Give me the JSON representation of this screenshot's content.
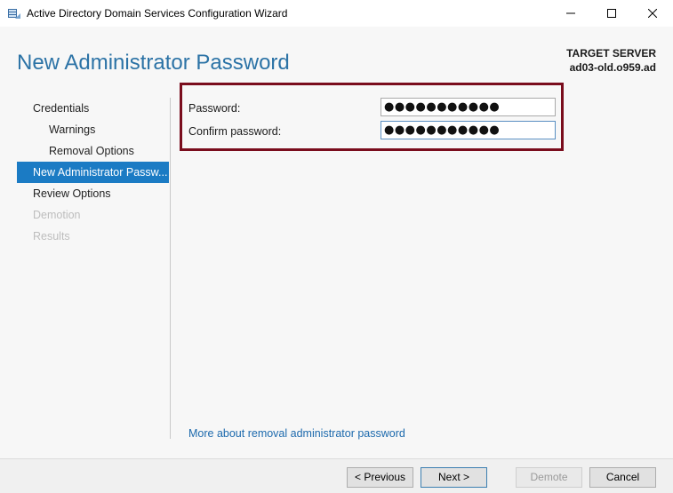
{
  "window": {
    "title": "Active Directory Domain Services Configuration Wizard",
    "icon": "server-wizard-icon",
    "controls": [
      "minimize-icon",
      "maximize-icon",
      "close-icon"
    ]
  },
  "header": {
    "page_title": "New Administrator Password",
    "target_label": "TARGET SERVER",
    "target_value": "ad03-old.o959.ad"
  },
  "nav": {
    "items": [
      {
        "label": "Credentials",
        "state": "normal",
        "level": "top"
      },
      {
        "label": "Warnings",
        "state": "normal",
        "level": "sub"
      },
      {
        "label": "Removal Options",
        "state": "normal",
        "level": "sub"
      },
      {
        "label": "New Administrator Passw...",
        "state": "active",
        "level": "top"
      },
      {
        "label": "Review Options",
        "state": "normal",
        "level": "top"
      },
      {
        "label": "Demotion",
        "state": "disabled",
        "level": "top"
      },
      {
        "label": "Results",
        "state": "disabled",
        "level": "top"
      }
    ]
  },
  "form": {
    "password_label": "Password:",
    "password_value": "●●●●●●●●●●●",
    "confirm_label": "Confirm password:",
    "confirm_value": "●●●●●●●●●●●"
  },
  "links": {
    "more_about": "More about removal administrator password"
  },
  "footer": {
    "previous": "< Previous",
    "next": "Next >",
    "demote": "Demote",
    "cancel": "Cancel"
  },
  "colors": {
    "title_blue": "#2c73a6",
    "nav_active": "#1b7bc4",
    "highlight_border": "#7a0d1d",
    "link": "#1d6aad"
  }
}
